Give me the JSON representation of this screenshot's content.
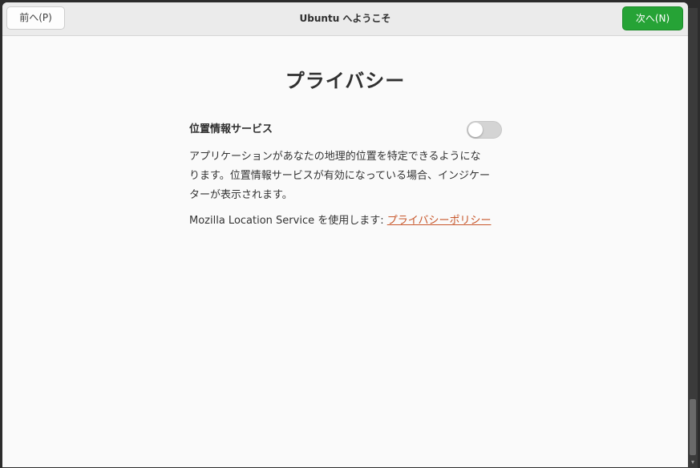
{
  "header": {
    "back_label": "前へ(P)",
    "title": "Ubuntu へようこそ",
    "next_label": "次へ(N)"
  },
  "page": {
    "title": "プライバシー"
  },
  "location_service": {
    "label": "位置情報サービス",
    "enabled": false,
    "description_lines": [
      "アプリケーションがあなたの地理的位置を特定できるようにな",
      "ります。位置情報サービスが有効になっている場合、インジケー",
      "ターが表示されます。"
    ],
    "mozilla_text": "Mozilla Location Service を使用します: ",
    "privacy_link": "プライバシーポリシー"
  },
  "colors": {
    "next_button": "#26a336",
    "link": "#c7562a",
    "toggle_off": "#d4d4d4"
  },
  "icons": {
    "scroll_down": "▾"
  }
}
